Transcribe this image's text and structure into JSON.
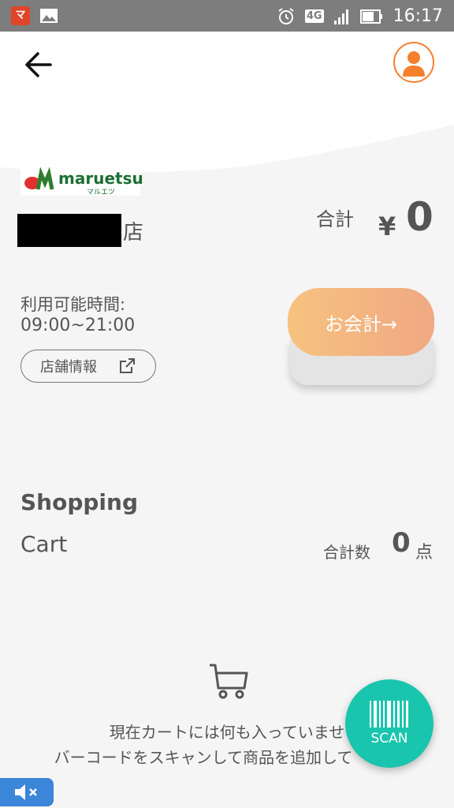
{
  "status_bar": {
    "time": "16:17",
    "network": "4G",
    "app_icon_glyph": "マ",
    "icons": [
      "app-notification-icon",
      "image-icon",
      "alarm-icon",
      "signal-icon",
      "battery-icon"
    ]
  },
  "header": {
    "back_icon": "arrow-left-icon",
    "account_icon": "user-avatar-icon",
    "accent_color": "#f47f2d"
  },
  "store": {
    "logo_text": "maruetsu",
    "logo_subtext": "マルエツ",
    "name_suffix": "店",
    "hours_label": "利用可能時間:",
    "hours_value": "09:00~21:00",
    "info_button_label": "店舗情報"
  },
  "total": {
    "label": "合計",
    "currency": "¥",
    "value": "0"
  },
  "checkout": {
    "label": "お会計→"
  },
  "cart": {
    "title": "Shopping",
    "subtitle": "Cart",
    "count_label": "合計数",
    "count_value": "0",
    "count_unit": "点",
    "empty_line1": "現在カートには何も入っていませ",
    "empty_line2": "バーコードをスキャンして商品を追加して　　い"
  },
  "scan_button": {
    "label": "SCAN",
    "color": "#19c5ad"
  }
}
